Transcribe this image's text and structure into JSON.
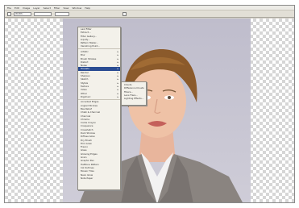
{
  "menubar": {
    "items": [
      "File",
      "Edit",
      "Image",
      "Layer",
      "Select",
      "Filter",
      "View",
      "Window",
      "Help"
    ]
  },
  "toolbar": {
    "field_a": "Width:",
    "field_b": "",
    "field_c": ""
  },
  "filter_menu": {
    "items": [
      {
        "label": "Last Filter",
        "arrow": ""
      },
      {
        "label": "Extract...",
        "arrow": ""
      },
      {
        "label": "Filter Gallery...",
        "arrow": ""
      },
      {
        "label": "Liquify...",
        "arrow": ""
      },
      {
        "label": "Pattern Maker...",
        "arrow": ""
      },
      {
        "label": "Vanishing Point...",
        "arrow": ""
      },
      {
        "label": "Artistic",
        "arrow": "▸"
      },
      {
        "label": "Blur",
        "arrow": "▸"
      },
      {
        "label": "Brush Strokes",
        "arrow": "▸"
      },
      {
        "label": "Distort",
        "arrow": "▸"
      },
      {
        "label": "Noise",
        "arrow": "▸"
      },
      {
        "label": "Pixelate",
        "arrow": "▸"
      },
      {
        "label": "Render",
        "arrow": "▸"
      },
      {
        "label": "Sharpen",
        "arrow": "▸"
      },
      {
        "label": "Sketch",
        "arrow": "▸"
      },
      {
        "label": "Stylize",
        "arrow": "▸"
      },
      {
        "label": "Texture",
        "arrow": "▸"
      },
      {
        "label": "Video",
        "arrow": "▸"
      },
      {
        "label": "Other",
        "arrow": "▸"
      },
      {
        "label": "Digimarc",
        "arrow": "▸"
      },
      {
        "label": "Accented Edges",
        "arrow": ""
      },
      {
        "label": "Angled Strokes",
        "arrow": ""
      },
      {
        "label": "Bas Relief",
        "arrow": ""
      },
      {
        "label": "Chalk & Charcoal",
        "arrow": ""
      },
      {
        "label": "Charcoal",
        "arrow": ""
      },
      {
        "label": "Chrome",
        "arrow": ""
      },
      {
        "label": "Conte Crayon",
        "arrow": ""
      },
      {
        "label": "Craquelure",
        "arrow": ""
      },
      {
        "label": "Crosshatch",
        "arrow": ""
      },
      {
        "label": "Dark Strokes",
        "arrow": ""
      },
      {
        "label": "Diffuse Glow",
        "arrow": ""
      },
      {
        "label": "Dry Brush",
        "arrow": ""
      },
      {
        "label": "Film Grain",
        "arrow": ""
      },
      {
        "label": "Fresco",
        "arrow": ""
      },
      {
        "label": "Glass",
        "arrow": ""
      },
      {
        "label": "Glowing Edges",
        "arrow": ""
      },
      {
        "label": "Grain",
        "arrow": ""
      },
      {
        "label": "Graphic Pen",
        "arrow": ""
      },
      {
        "label": "Halftone Pattern",
        "arrow": ""
      },
      {
        "label": "Ink Outlines",
        "arrow": ""
      },
      {
        "label": "Mosaic Tiles",
        "arrow": ""
      },
      {
        "label": "Neon Glow",
        "arrow": ""
      },
      {
        "label": "Note Paper",
        "arrow": ""
      }
    ],
    "active_index": 11
  },
  "submenu": {
    "items": [
      "Clouds",
      "Difference Clouds",
      "Fibers...",
      "Lens Flare...",
      "Lighting Effects..."
    ]
  },
  "colors": {
    "menu_highlight": "#2a4c92",
    "background": "#c3c1cf",
    "hair": "#8b5a2b",
    "jacket": "#8a8480",
    "shirt": "#f3f2f2"
  }
}
